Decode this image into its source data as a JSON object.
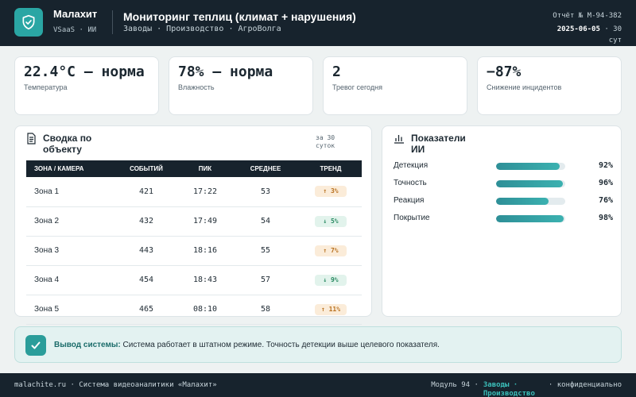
{
  "header": {
    "brand_name": "Малахит",
    "brand_sub": "VSaaS · ИИ",
    "title": "Мониторинг теплиц (климат + нарушения)",
    "breadcrumbs": "Заводы · Производство · АгроВолга",
    "report": "Отчёт № М-94-382",
    "date": "2025-06-05",
    "period": "· 30 сут"
  },
  "kpis": [
    {
      "value": "22.4°C — норма",
      "label": "Температура"
    },
    {
      "value": "78% — норма",
      "label": "Влажность"
    },
    {
      "value": "2",
      "label": "Тревог сегодня"
    },
    {
      "value": "−87%",
      "label": "Снижение инцидентов"
    }
  ],
  "summary": {
    "title": "Сводка по объекту",
    "period": "за 30 суток",
    "columns": [
      "ЗОНА / КАМЕРА",
      "СОБЫТИЙ",
      "ПИК",
      "СРЕДНЕЕ",
      "ТРЕНД"
    ],
    "rows": [
      {
        "zone": "Зона 1",
        "events": "421",
        "peak": "17:22",
        "avg": "53",
        "trend": "↑ 3%"
      },
      {
        "zone": "Зона 2",
        "events": "432",
        "peak": "17:49",
        "avg": "54",
        "trend": "↓ 5%"
      },
      {
        "zone": "Зона 3",
        "events": "443",
        "peak": "18:16",
        "avg": "55",
        "trend": "↑ 7%"
      },
      {
        "zone": "Зона 4",
        "events": "454",
        "peak": "18:43",
        "avg": "57",
        "trend": "↓ 9%"
      },
      {
        "zone": "Зона 5",
        "events": "465",
        "peak": "08:10",
        "avg": "58",
        "trend": "↑ 11%"
      }
    ]
  },
  "ai": {
    "title": "Показатели ИИ",
    "metrics": [
      {
        "label": "Детекция",
        "pct": "92%",
        "value": 92
      },
      {
        "label": "Точность",
        "pct": "96%",
        "value": 96
      },
      {
        "label": "Реакция",
        "pct": "76%",
        "value": 76
      },
      {
        "label": "Покрытие",
        "pct": "98%",
        "value": 98
      }
    ]
  },
  "conclusion": {
    "label": "Вывод системы:",
    "text": " Система работает в штатном режиме. Точность детекции выше целевого показателя."
  },
  "footer": {
    "left": "malachite.ru · Система видеоаналитики «Малахит»",
    "module": "Модуль 94 ·",
    "teal": "Заводы · Производство",
    "right": "· конфиденциально"
  }
}
